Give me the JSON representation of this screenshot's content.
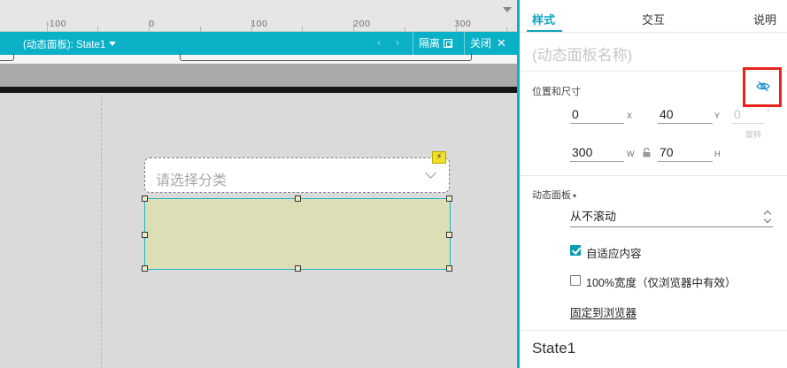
{
  "ruler": {
    "labels": [
      "-100",
      "0",
      "100",
      "200",
      "300"
    ]
  },
  "state_bar": {
    "state_dropdown": "(动态面板): State1",
    "nav_prev": "‹",
    "nav_next": "›",
    "hide_label": "隔离",
    "close_label": "关闭",
    "close_icon": "✕"
  },
  "canvas": {
    "select_placeholder": "请选择分类",
    "interaction_badge": "⚡"
  },
  "inspector": {
    "tabs": {
      "style": "样式",
      "interactions": "交互",
      "notes": "说明"
    },
    "name_placeholder": "(动态面板名称)",
    "position_size": {
      "title": "位置和尺寸",
      "x": "0",
      "x_label": "X",
      "y": "40",
      "y_label": "Y",
      "rotation": "0",
      "rotation_label": "旋转",
      "rotation_unit": "°",
      "w": "300",
      "w_label": "W",
      "h": "70",
      "h_label": "H"
    },
    "dynamic_panel": {
      "title": "动态面板",
      "title_caret": "▾",
      "scroll_mode": "从不滚动",
      "fit_content_label": "自适应内容",
      "fit_content_checked": true,
      "full_width_label": "100%宽度（仅浏览器中有效）",
      "full_width_checked": false,
      "pin_label": "固定到浏览器"
    },
    "state_name": "State1"
  },
  "colors": {
    "accent": "#0ab0c6",
    "highlight_box": "#e8231b",
    "panel_fill": "#dcdfb5"
  },
  "icons": {
    "visibility": "eye-slash-icon",
    "lock": "lock-icon",
    "chevron": "chevron-down-icon"
  }
}
